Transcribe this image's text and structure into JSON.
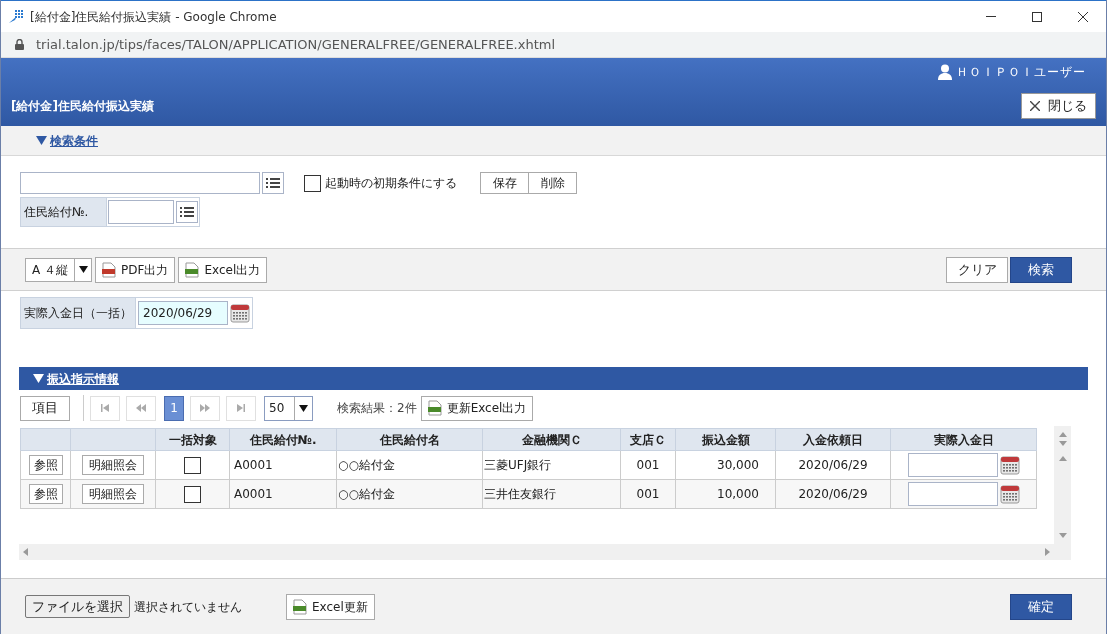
{
  "window": {
    "title": "[給付金]住民給付振込実績 - Google Chrome",
    "url": "trial.talon.jp/tips/faces/TALON/APPLICATION/GENERALFREE/GENERALFREE.xhtml"
  },
  "header": {
    "user": "ＨＯＩＰＯＩユーザー",
    "page_title": "[給付金]住民給付振込実績",
    "close_button": "閉じる"
  },
  "search_section": {
    "title": "検索条件",
    "expanded": true
  },
  "search": {
    "default_checkbox": {
      "label": "起動時の初期条件にする",
      "checked": false
    },
    "buttons": [
      "保存",
      "削除"
    ],
    "fields": [
      {
        "label": "住民給付№."
      }
    ]
  },
  "toolbar": {
    "paper_size": "A ４縦",
    "output_buttons": [
      {
        "kind": "pdf",
        "label": "PDF出力"
      },
      {
        "kind": "excel",
        "label": "Excel出力"
      }
    ],
    "clear_button": "クリア",
    "search_button": "検索"
  },
  "bulk_date": {
    "label": "実際入金日（一括）",
    "value": "2020/06/29"
  },
  "transfer_section": {
    "title": "振込指示情報",
    "expanded": true
  },
  "pager": {
    "items_button": "項目",
    "pages": [
      {
        "label": "1",
        "selected": true
      }
    ],
    "page_size": "50",
    "result": "検索結果：2件",
    "export_button": "更新Excel出力"
  },
  "table": {
    "columns": [
      "一括対象",
      "住民給付№.",
      "住民給付名",
      "金融機関Ｃ",
      "支店Ｃ",
      "振込金額",
      "入金依頼日",
      "実際入金日"
    ],
    "rows": [
      {
        "ref_button": "参照",
        "detail_button": "明細照会",
        "bulk_target": false,
        "number": "A0001",
        "name": "○○給付金",
        "bank": "三菱UFJ銀行",
        "branch": "001",
        "amount": "30,000",
        "request_date": "2020/06/29"
      },
      {
        "ref_button": "参照",
        "detail_button": "明細照会",
        "bulk_target": false,
        "number": "A0001",
        "name": "○○給付金",
        "bank": "三井住友銀行",
        "branch": "001",
        "amount": "10,000",
        "request_date": "2020/06/29"
      }
    ]
  },
  "footer": {
    "file_button": "ファイルを選択",
    "file_status": "選択されていません",
    "excel_update_button": "Excel更新",
    "confirm_button": "確定"
  }
}
